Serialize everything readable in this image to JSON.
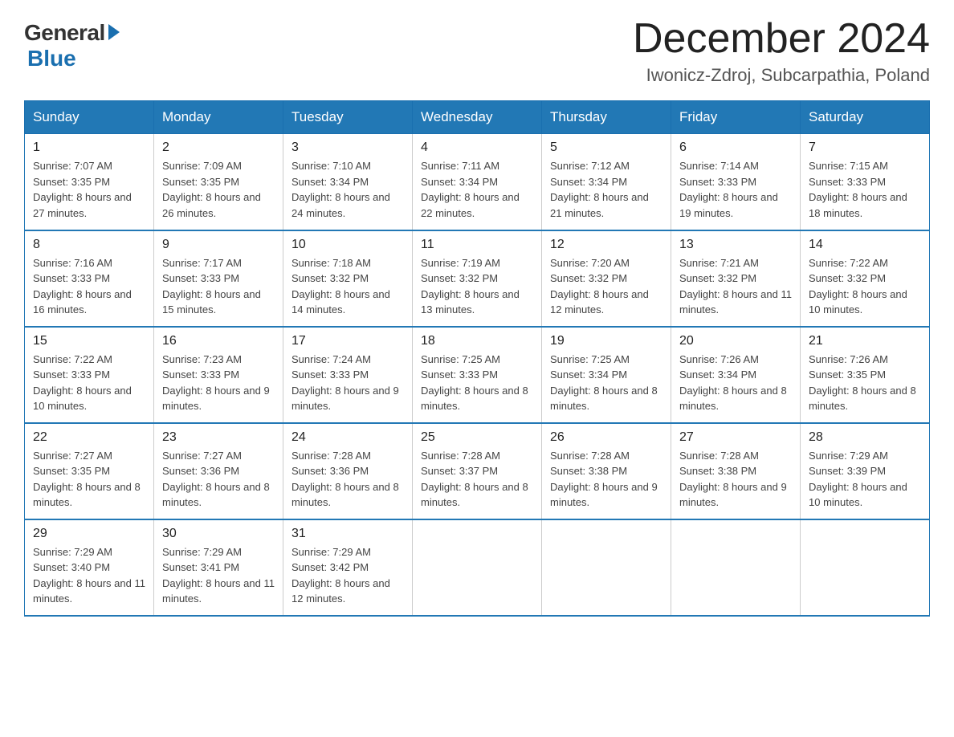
{
  "logo": {
    "general": "General",
    "blue": "Blue"
  },
  "title": "December 2024",
  "location": "Iwonicz-Zdroj, Subcarpathia, Poland",
  "days_of_week": [
    "Sunday",
    "Monday",
    "Tuesday",
    "Wednesday",
    "Thursday",
    "Friday",
    "Saturday"
  ],
  "weeks": [
    [
      {
        "day": "1",
        "sunrise": "7:07 AM",
        "sunset": "3:35 PM",
        "daylight": "8 hours and 27 minutes."
      },
      {
        "day": "2",
        "sunrise": "7:09 AM",
        "sunset": "3:35 PM",
        "daylight": "8 hours and 26 minutes."
      },
      {
        "day": "3",
        "sunrise": "7:10 AM",
        "sunset": "3:34 PM",
        "daylight": "8 hours and 24 minutes."
      },
      {
        "day": "4",
        "sunrise": "7:11 AM",
        "sunset": "3:34 PM",
        "daylight": "8 hours and 22 minutes."
      },
      {
        "day": "5",
        "sunrise": "7:12 AM",
        "sunset": "3:34 PM",
        "daylight": "8 hours and 21 minutes."
      },
      {
        "day": "6",
        "sunrise": "7:14 AM",
        "sunset": "3:33 PM",
        "daylight": "8 hours and 19 minutes."
      },
      {
        "day": "7",
        "sunrise": "7:15 AM",
        "sunset": "3:33 PM",
        "daylight": "8 hours and 18 minutes."
      }
    ],
    [
      {
        "day": "8",
        "sunrise": "7:16 AM",
        "sunset": "3:33 PM",
        "daylight": "8 hours and 16 minutes."
      },
      {
        "day": "9",
        "sunrise": "7:17 AM",
        "sunset": "3:33 PM",
        "daylight": "8 hours and 15 minutes."
      },
      {
        "day": "10",
        "sunrise": "7:18 AM",
        "sunset": "3:32 PM",
        "daylight": "8 hours and 14 minutes."
      },
      {
        "day": "11",
        "sunrise": "7:19 AM",
        "sunset": "3:32 PM",
        "daylight": "8 hours and 13 minutes."
      },
      {
        "day": "12",
        "sunrise": "7:20 AM",
        "sunset": "3:32 PM",
        "daylight": "8 hours and 12 minutes."
      },
      {
        "day": "13",
        "sunrise": "7:21 AM",
        "sunset": "3:32 PM",
        "daylight": "8 hours and 11 minutes."
      },
      {
        "day": "14",
        "sunrise": "7:22 AM",
        "sunset": "3:32 PM",
        "daylight": "8 hours and 10 minutes."
      }
    ],
    [
      {
        "day": "15",
        "sunrise": "7:22 AM",
        "sunset": "3:33 PM",
        "daylight": "8 hours and 10 minutes."
      },
      {
        "day": "16",
        "sunrise": "7:23 AM",
        "sunset": "3:33 PM",
        "daylight": "8 hours and 9 minutes."
      },
      {
        "day": "17",
        "sunrise": "7:24 AM",
        "sunset": "3:33 PM",
        "daylight": "8 hours and 9 minutes."
      },
      {
        "day": "18",
        "sunrise": "7:25 AM",
        "sunset": "3:33 PM",
        "daylight": "8 hours and 8 minutes."
      },
      {
        "day": "19",
        "sunrise": "7:25 AM",
        "sunset": "3:34 PM",
        "daylight": "8 hours and 8 minutes."
      },
      {
        "day": "20",
        "sunrise": "7:26 AM",
        "sunset": "3:34 PM",
        "daylight": "8 hours and 8 minutes."
      },
      {
        "day": "21",
        "sunrise": "7:26 AM",
        "sunset": "3:35 PM",
        "daylight": "8 hours and 8 minutes."
      }
    ],
    [
      {
        "day": "22",
        "sunrise": "7:27 AM",
        "sunset": "3:35 PM",
        "daylight": "8 hours and 8 minutes."
      },
      {
        "day": "23",
        "sunrise": "7:27 AM",
        "sunset": "3:36 PM",
        "daylight": "8 hours and 8 minutes."
      },
      {
        "day": "24",
        "sunrise": "7:28 AM",
        "sunset": "3:36 PM",
        "daylight": "8 hours and 8 minutes."
      },
      {
        "day": "25",
        "sunrise": "7:28 AM",
        "sunset": "3:37 PM",
        "daylight": "8 hours and 8 minutes."
      },
      {
        "day": "26",
        "sunrise": "7:28 AM",
        "sunset": "3:38 PM",
        "daylight": "8 hours and 9 minutes."
      },
      {
        "day": "27",
        "sunrise": "7:28 AM",
        "sunset": "3:38 PM",
        "daylight": "8 hours and 9 minutes."
      },
      {
        "day": "28",
        "sunrise": "7:29 AM",
        "sunset": "3:39 PM",
        "daylight": "8 hours and 10 minutes."
      }
    ],
    [
      {
        "day": "29",
        "sunrise": "7:29 AM",
        "sunset": "3:40 PM",
        "daylight": "8 hours and 11 minutes."
      },
      {
        "day": "30",
        "sunrise": "7:29 AM",
        "sunset": "3:41 PM",
        "daylight": "8 hours and 11 minutes."
      },
      {
        "day": "31",
        "sunrise": "7:29 AM",
        "sunset": "3:42 PM",
        "daylight": "8 hours and 12 minutes."
      },
      null,
      null,
      null,
      null
    ]
  ]
}
